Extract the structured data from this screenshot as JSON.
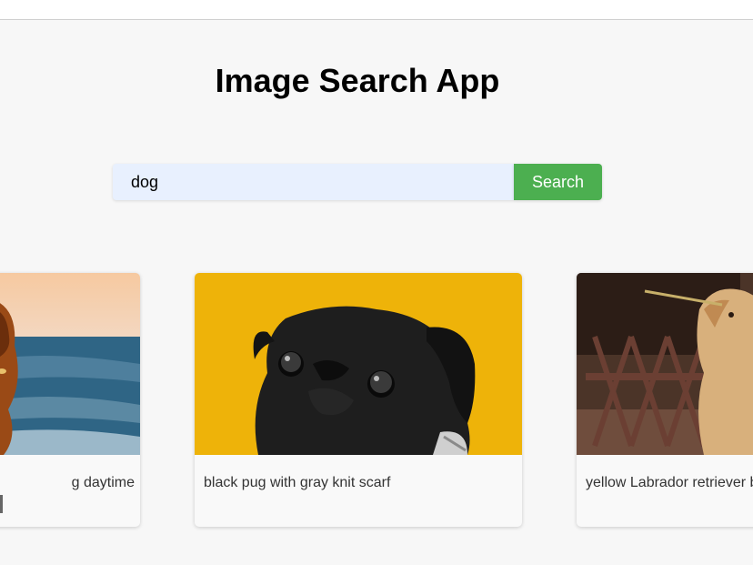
{
  "header": {
    "title": "Image Search App"
  },
  "search": {
    "value": "dog",
    "button_label": "Search"
  },
  "results": [
    {
      "caption": "g daytime",
      "image": "dog-on-beach-photo"
    },
    {
      "caption": "black pug with gray knit scarf",
      "image": "black-pug-photo"
    },
    {
      "caption": "yellow Labrador retriever b flower",
      "image": "golden-retriever-photo"
    }
  ],
  "colors": {
    "accent": "#4caf50",
    "input_bg": "#e8f0fe",
    "page_bg": "#f7f7f7"
  }
}
